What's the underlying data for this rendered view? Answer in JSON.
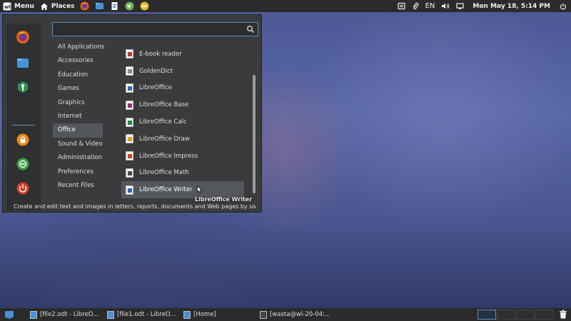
{
  "top_panel": {
    "menu_label": "Menu",
    "places_label": "Places",
    "clock": "Mon May 18,  5:14 PM",
    "keyboard_layout": "EN",
    "launchers": [
      "firefox-icon",
      "files-icon",
      "document-icon",
      "sound-icon",
      "media-icon"
    ]
  },
  "menu": {
    "search": {
      "value": "",
      "placeholder": ""
    },
    "favorites": [
      "firefox-icon",
      "files-icon",
      "settings-icon",
      "lock-icon",
      "logout-icon",
      "power-icon"
    ],
    "categories": [
      "All Applications",
      "Accessories",
      "Education",
      "Games",
      "Graphics",
      "Internet",
      "Office",
      "Sound & Video",
      "Administration",
      "Preferences",
      "Recent Files"
    ],
    "selected_category": "Office",
    "apps": [
      {
        "label": "E-book reader",
        "color": "#c0392b"
      },
      {
        "label": "GoldenDict",
        "color": "#8d8d8d"
      },
      {
        "label": "LibreOffice",
        "color": "#2a6aad"
      },
      {
        "label": "LibreOffice Base",
        "color": "#a2277d"
      },
      {
        "label": "LibreOffice Calc",
        "color": "#1e8f3c"
      },
      {
        "label": "LibreOffice Draw",
        "color": "#d8a018"
      },
      {
        "label": "LibreOffice Impress",
        "color": "#d2451e"
      },
      {
        "label": "LibreOffice Math",
        "color": "#4a4a4a"
      },
      {
        "label": "LibreOffice Writer",
        "color": "#2a6aad"
      }
    ],
    "hovered_app": "LibreOffice Writer",
    "description": "Create and edit text and images in letters, reports, documents and Web pages by usi...",
    "tooltip": "LibreOffice Writer"
  },
  "bottom_panel": {
    "tasks": [
      {
        "label": "[file2.odt - LibreO...",
        "icon": "writer-icon"
      },
      {
        "label": "[file1.odt - LibreO...",
        "icon": "writer-icon"
      },
      {
        "label": "[Home]",
        "icon": "folder-icon"
      },
      {
        "label": "[wasta@wl-20-04:...",
        "icon": "terminal-icon"
      }
    ],
    "workspaces": 4,
    "active_workspace": 1
  },
  "colors": {
    "accent": "#5e8ebb",
    "panel": "#2b2b2b",
    "menu_bg": "#3a3b3d"
  }
}
